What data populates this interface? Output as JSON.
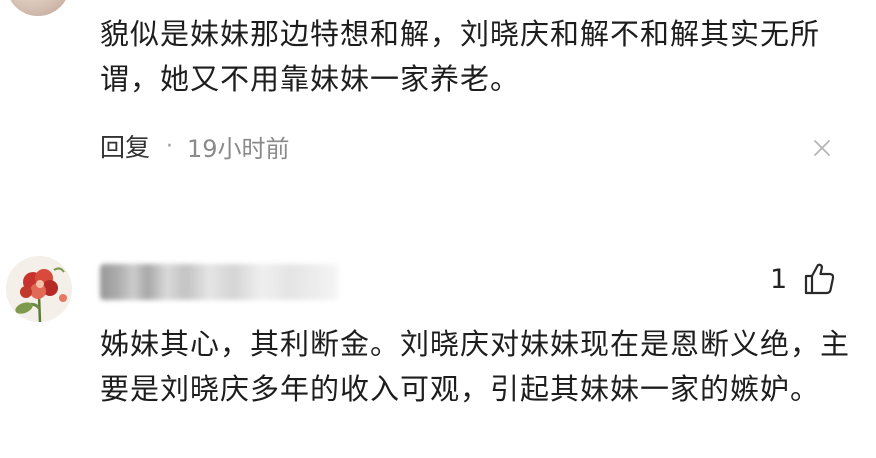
{
  "comments": [
    {
      "text": "貌似是妹妹那边特想和解，刘晓庆和解不和解其实无所谓，她又不用靠妹妹一家养老。",
      "reply_label": "回复",
      "separator": "·",
      "time": "19小时前"
    },
    {
      "likes": "1",
      "text": "姊妹其心，其利断金。刘晓庆对妹妹现在是恩断义绝，主要是刘晓庆多年的收入可观，引起其妹妹一家的嫉妒。"
    }
  ],
  "icons": {
    "close": "close-icon",
    "like": "thumbs-up-icon",
    "avatar2_art": "red-flower-avatar"
  },
  "colors": {
    "text": "#1d1d1d",
    "meta": "#8a8a8a",
    "flower": "#c8322c"
  }
}
